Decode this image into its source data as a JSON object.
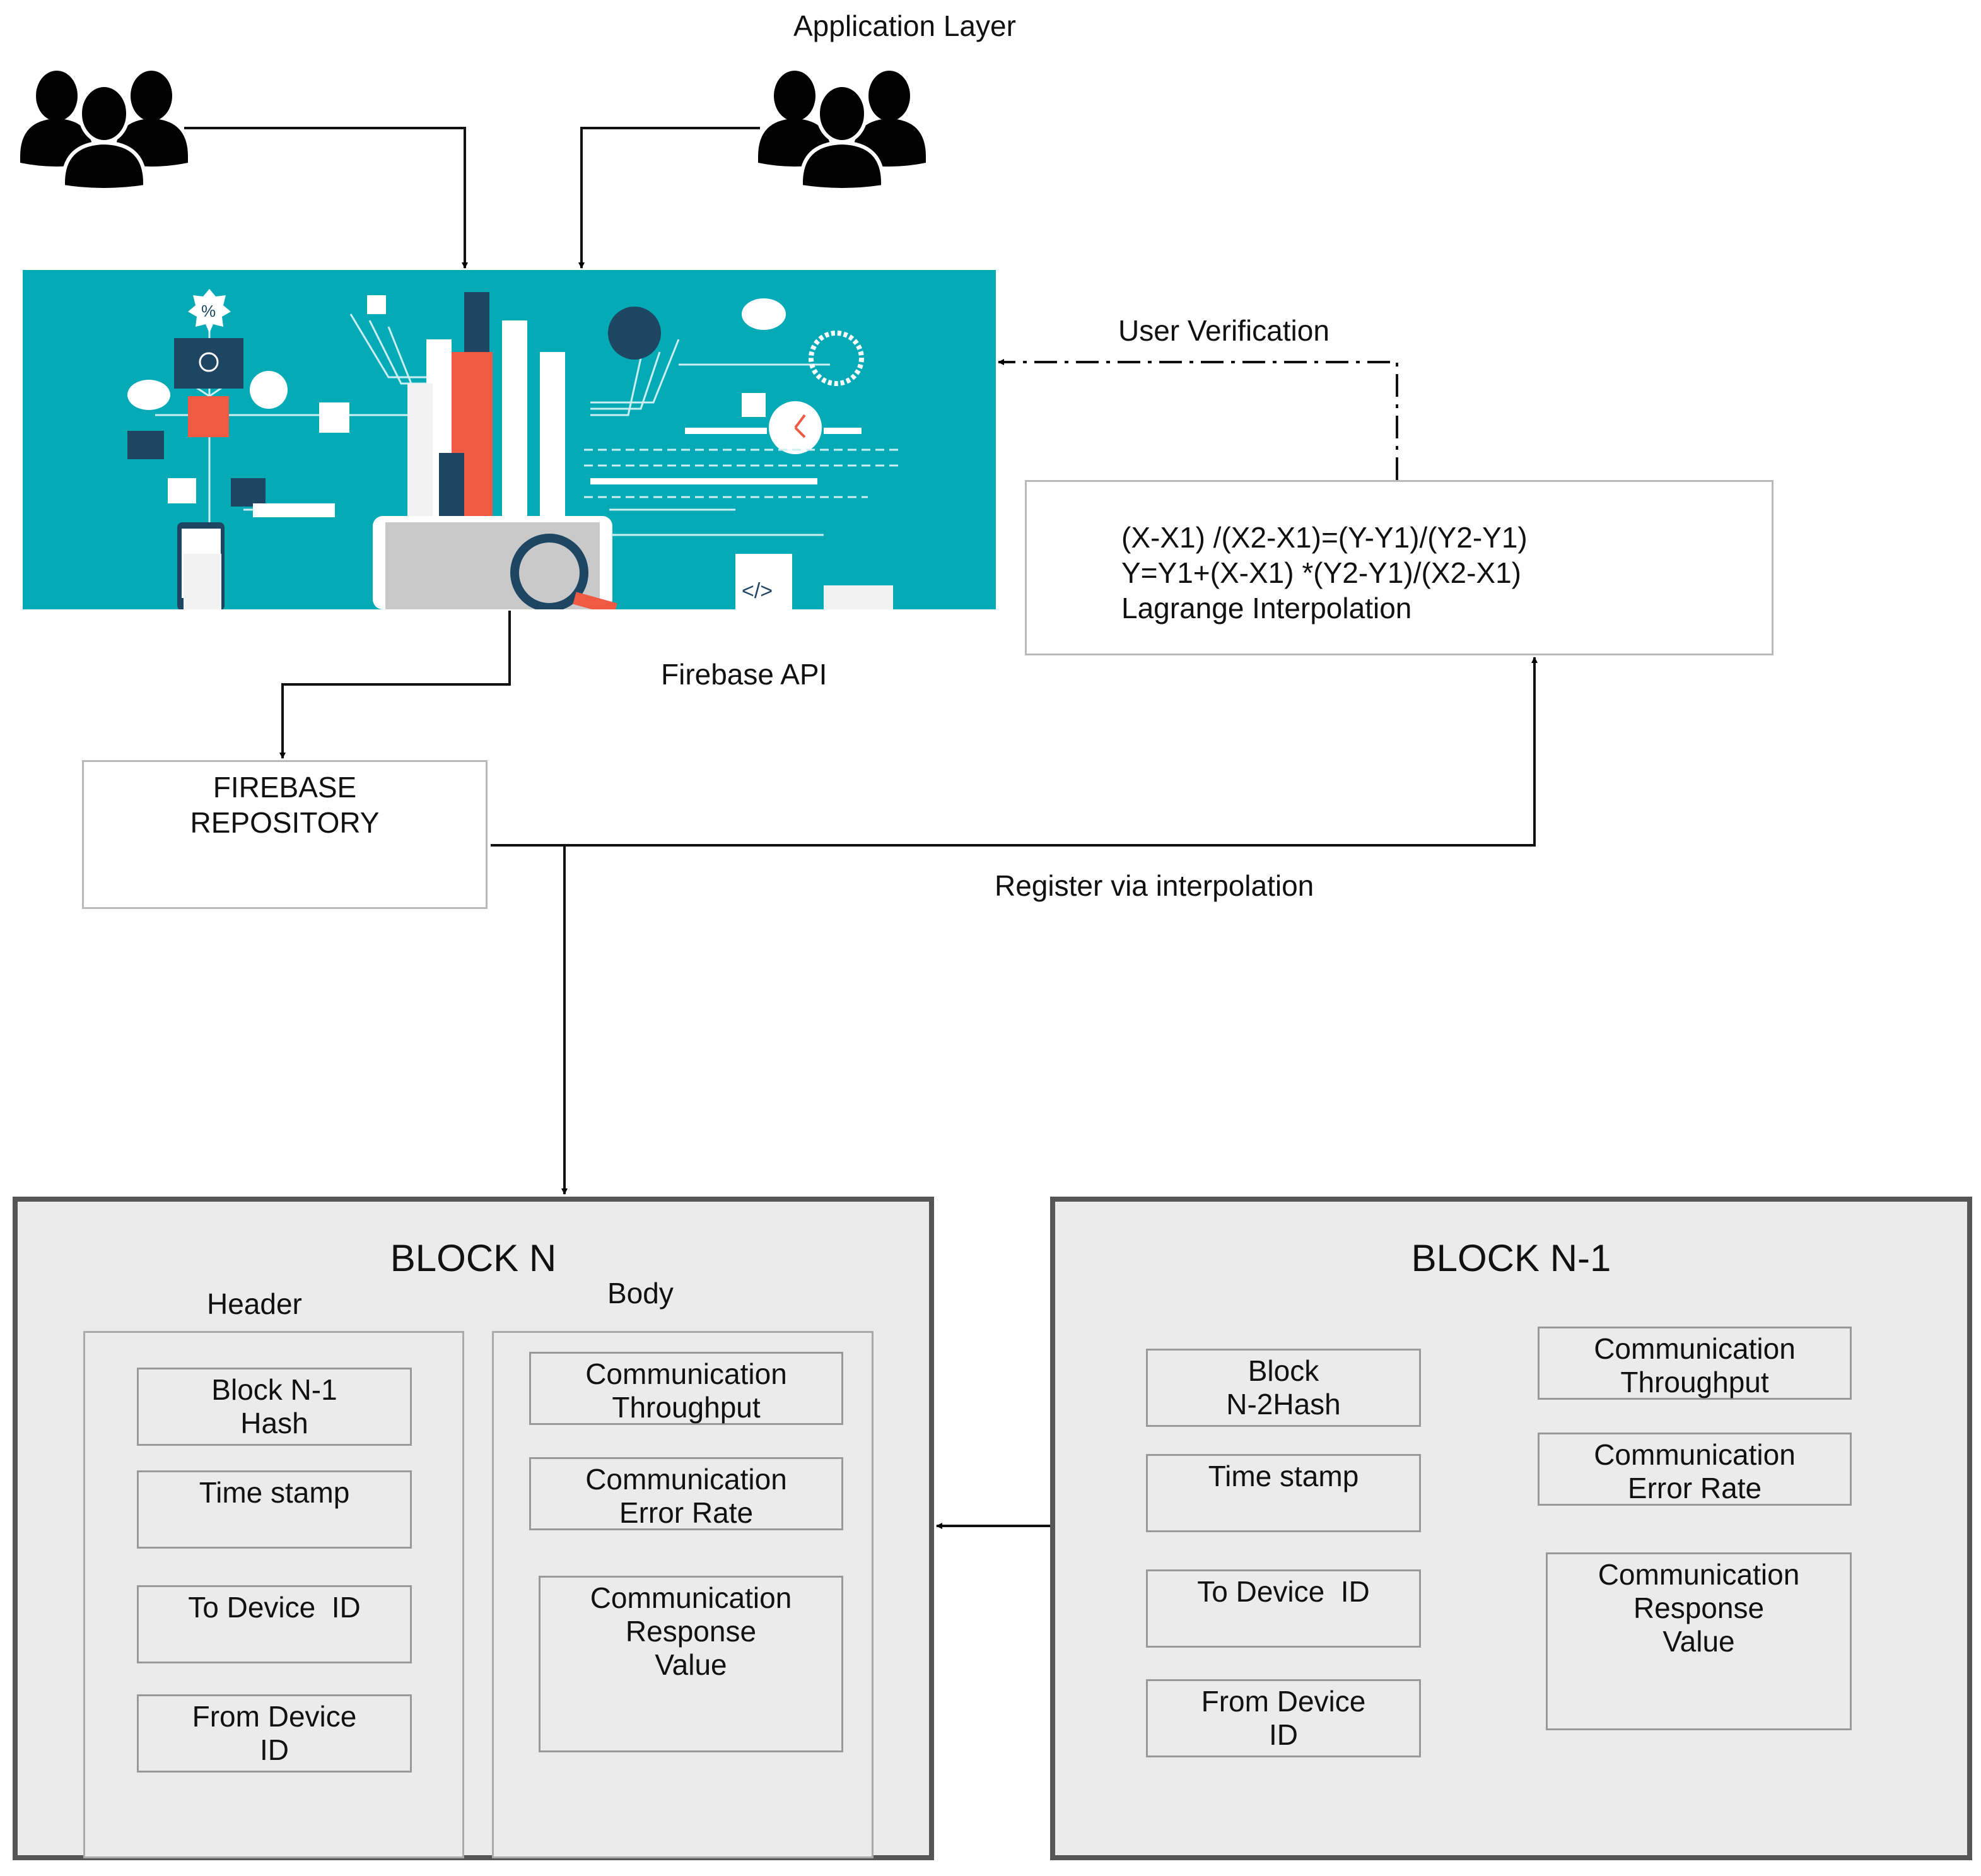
{
  "diagram": {
    "application_layer_label": "Application Layer",
    "user_groups": [
      {
        "icon": "users-group-icon",
        "position": "left"
      },
      {
        "icon": "users-group-icon",
        "position": "right"
      }
    ],
    "banner": {
      "icon": "data-analytics-illustration",
      "background": "#04abb6",
      "accent": "#f05a43",
      "dark": "#1e4663"
    },
    "edges": {
      "user_verification": "User Verification",
      "firebase_api": "Firebase API",
      "register_via_interpolation": "Register via interpolation"
    },
    "interpolation_box": {
      "line1": "(X-X1) /(X2-X1)=(Y-Y1)/(Y2-Y1)",
      "line2": "Y=Y1+(X-X1) *(Y2-Y1)/(X2-X1)",
      "line3": "Lagrange Interpolation"
    },
    "firebase_repository": {
      "line1": "FIREBASE",
      "line2": "REPOSITORY"
    },
    "block_n": {
      "title": "BLOCK N",
      "header_label": "Header",
      "body_label": "Body",
      "header_fields": [
        "Block N-1\nHash",
        "Time stamp",
        "To Device  ID",
        "From Device\nID"
      ],
      "body_fields": [
        "Communication\nThroughput",
        "Communication\nError Rate",
        "Communication\nResponse\nValue"
      ]
    },
    "block_n_minus_1": {
      "title": "BLOCK N-1",
      "header_fields": [
        "Block\nN-2Hash",
        "Time stamp",
        "To Device  ID",
        "From Device\nID"
      ],
      "body_fields": [
        "Communication\nThroughput",
        "Communication\nError Rate",
        "Communication\nResponse\nValue"
      ]
    }
  }
}
